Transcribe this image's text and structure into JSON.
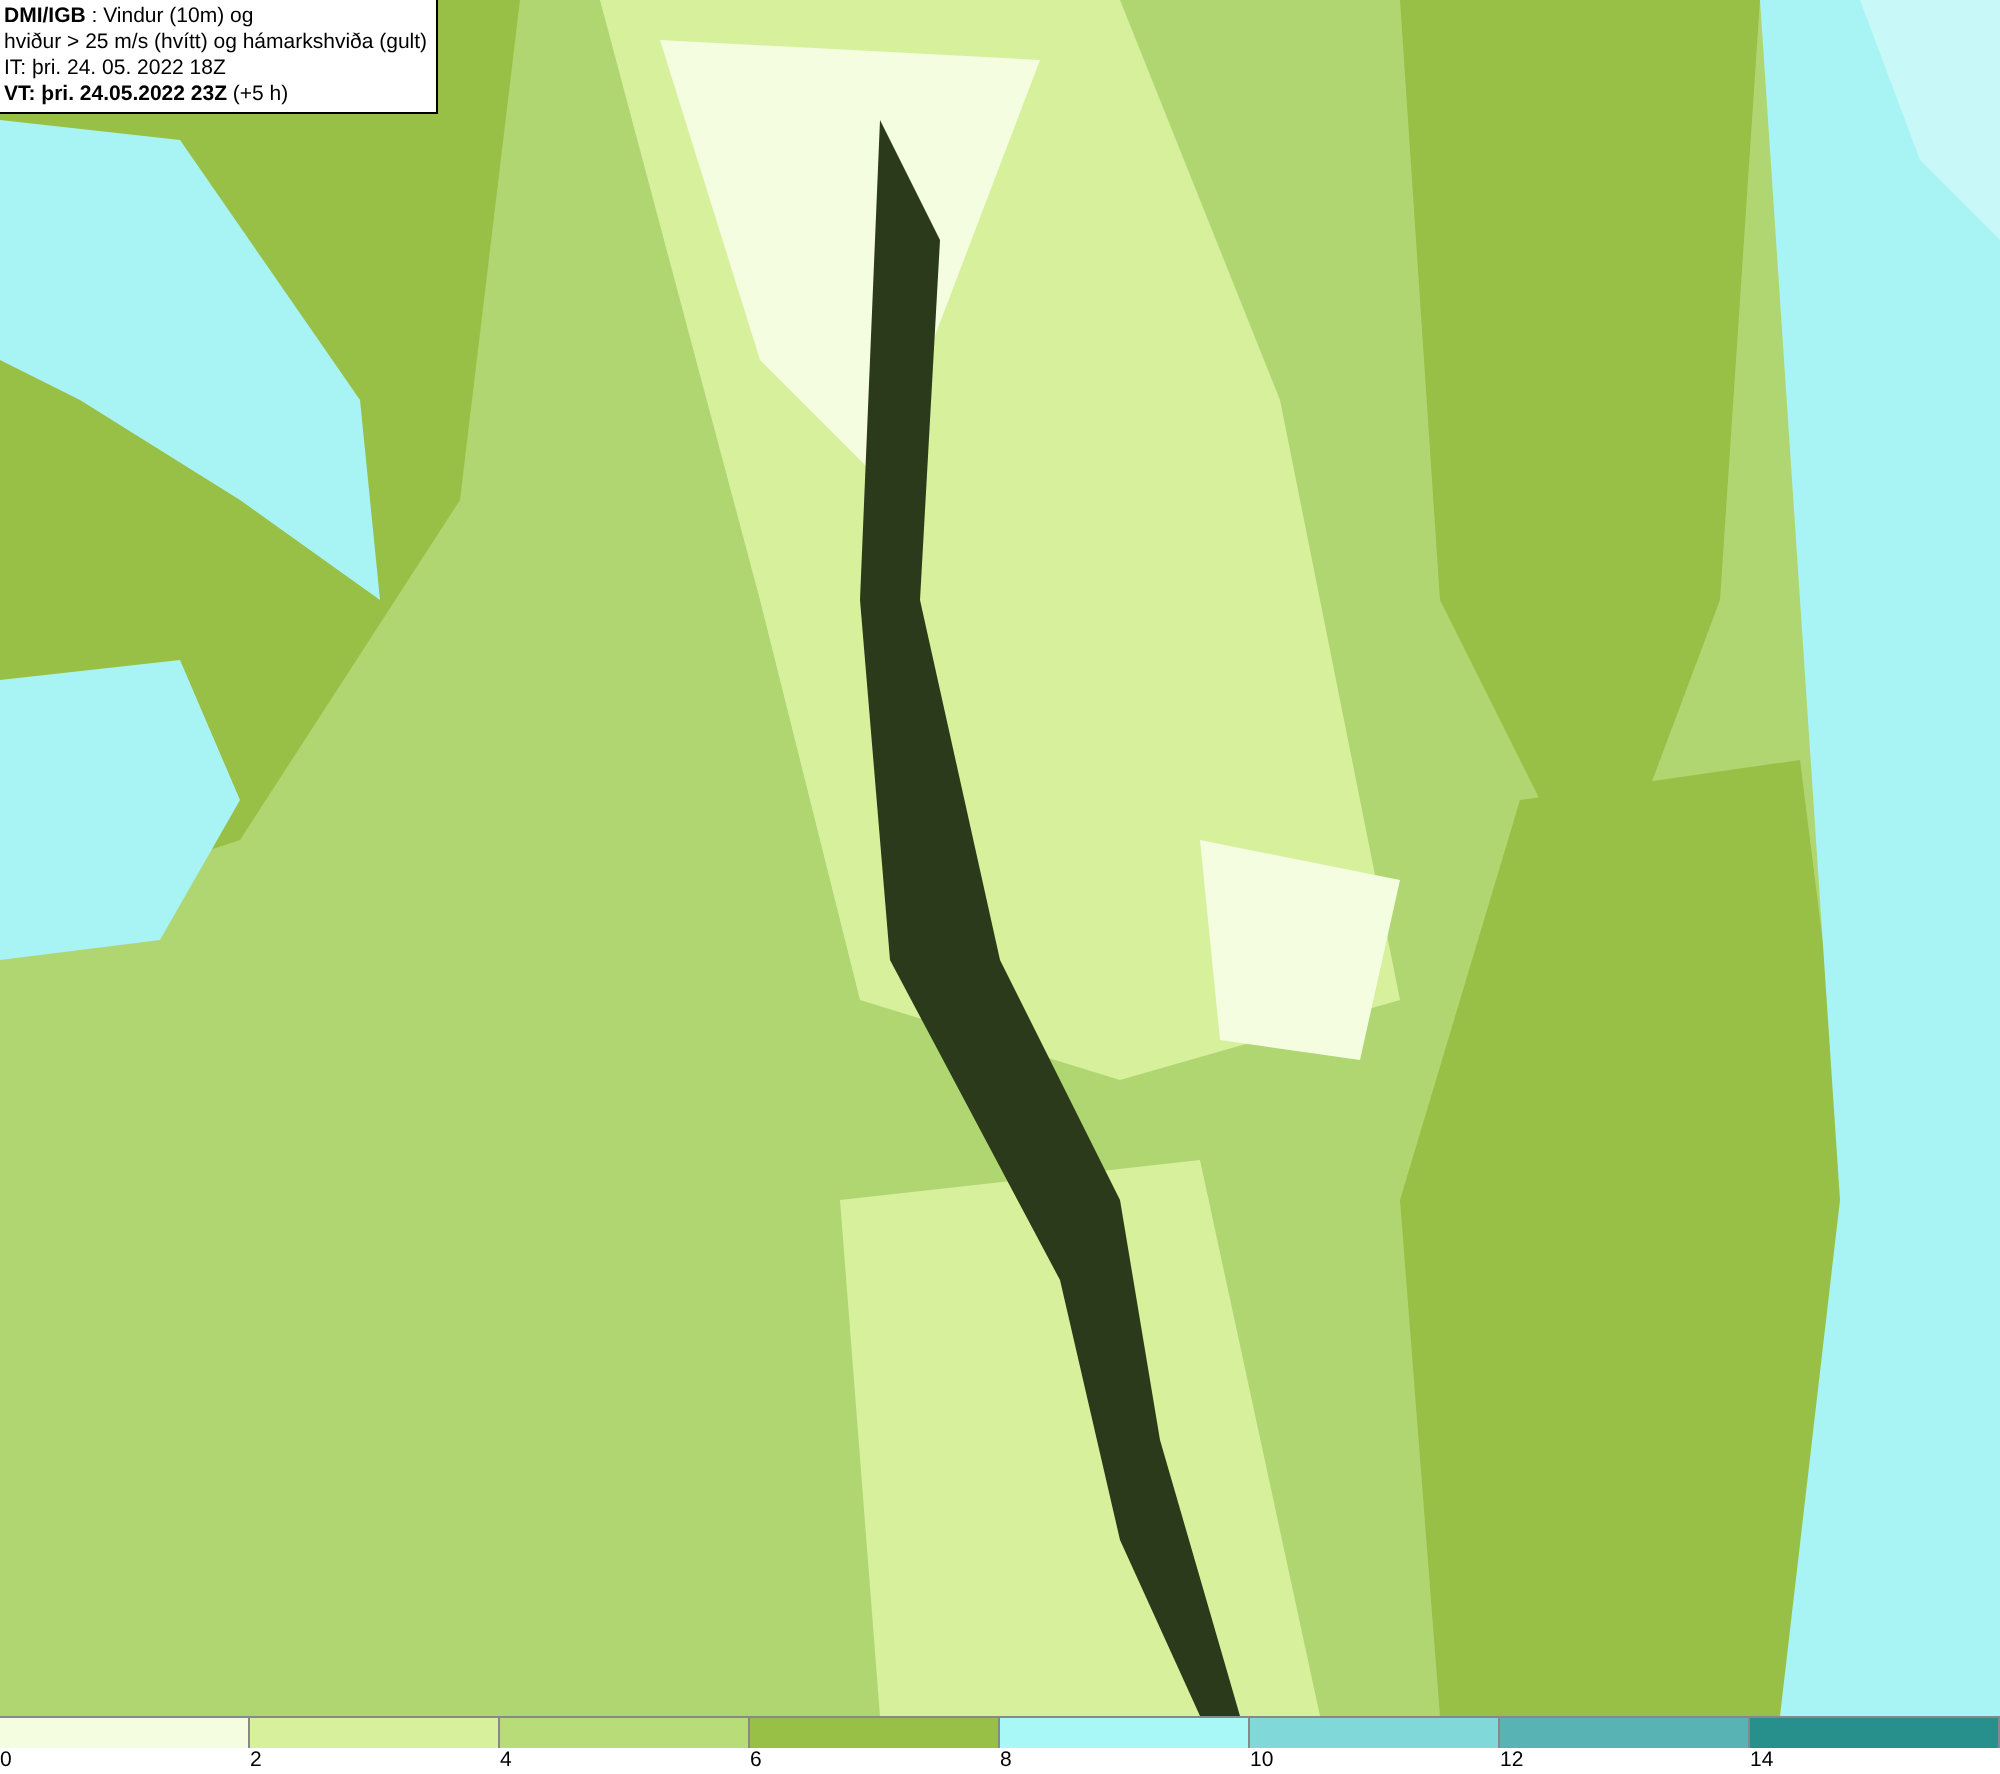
{
  "info_box": {
    "lines": [
      "**DMI/IGB** : Vindur (10m) og",
      "hviður > 25 m/s (hvítt) og hámarkshviða (gult)",
      "IT: þri. 24. 05. 2022 18Z",
      "**VT: þri. 24.05.2022 23Z** (+5 h)"
    ]
  },
  "legend": {
    "segments": [
      {
        "label": "0",
        "color": "#f4fde0"
      },
      {
        "label": "2",
        "color": "#d6f09c"
      },
      {
        "label": "4",
        "color": "#b8dc78"
      },
      {
        "label": "6",
        "color": "#98c046"
      },
      {
        "label": "8",
        "color": "#a8f8f8"
      },
      {
        "label": "10",
        "color": "#80d8d8"
      },
      {
        "label": "12",
        "color": "#58b4b4"
      },
      {
        "label": "14",
        "color": "#28908c"
      }
    ]
  }
}
